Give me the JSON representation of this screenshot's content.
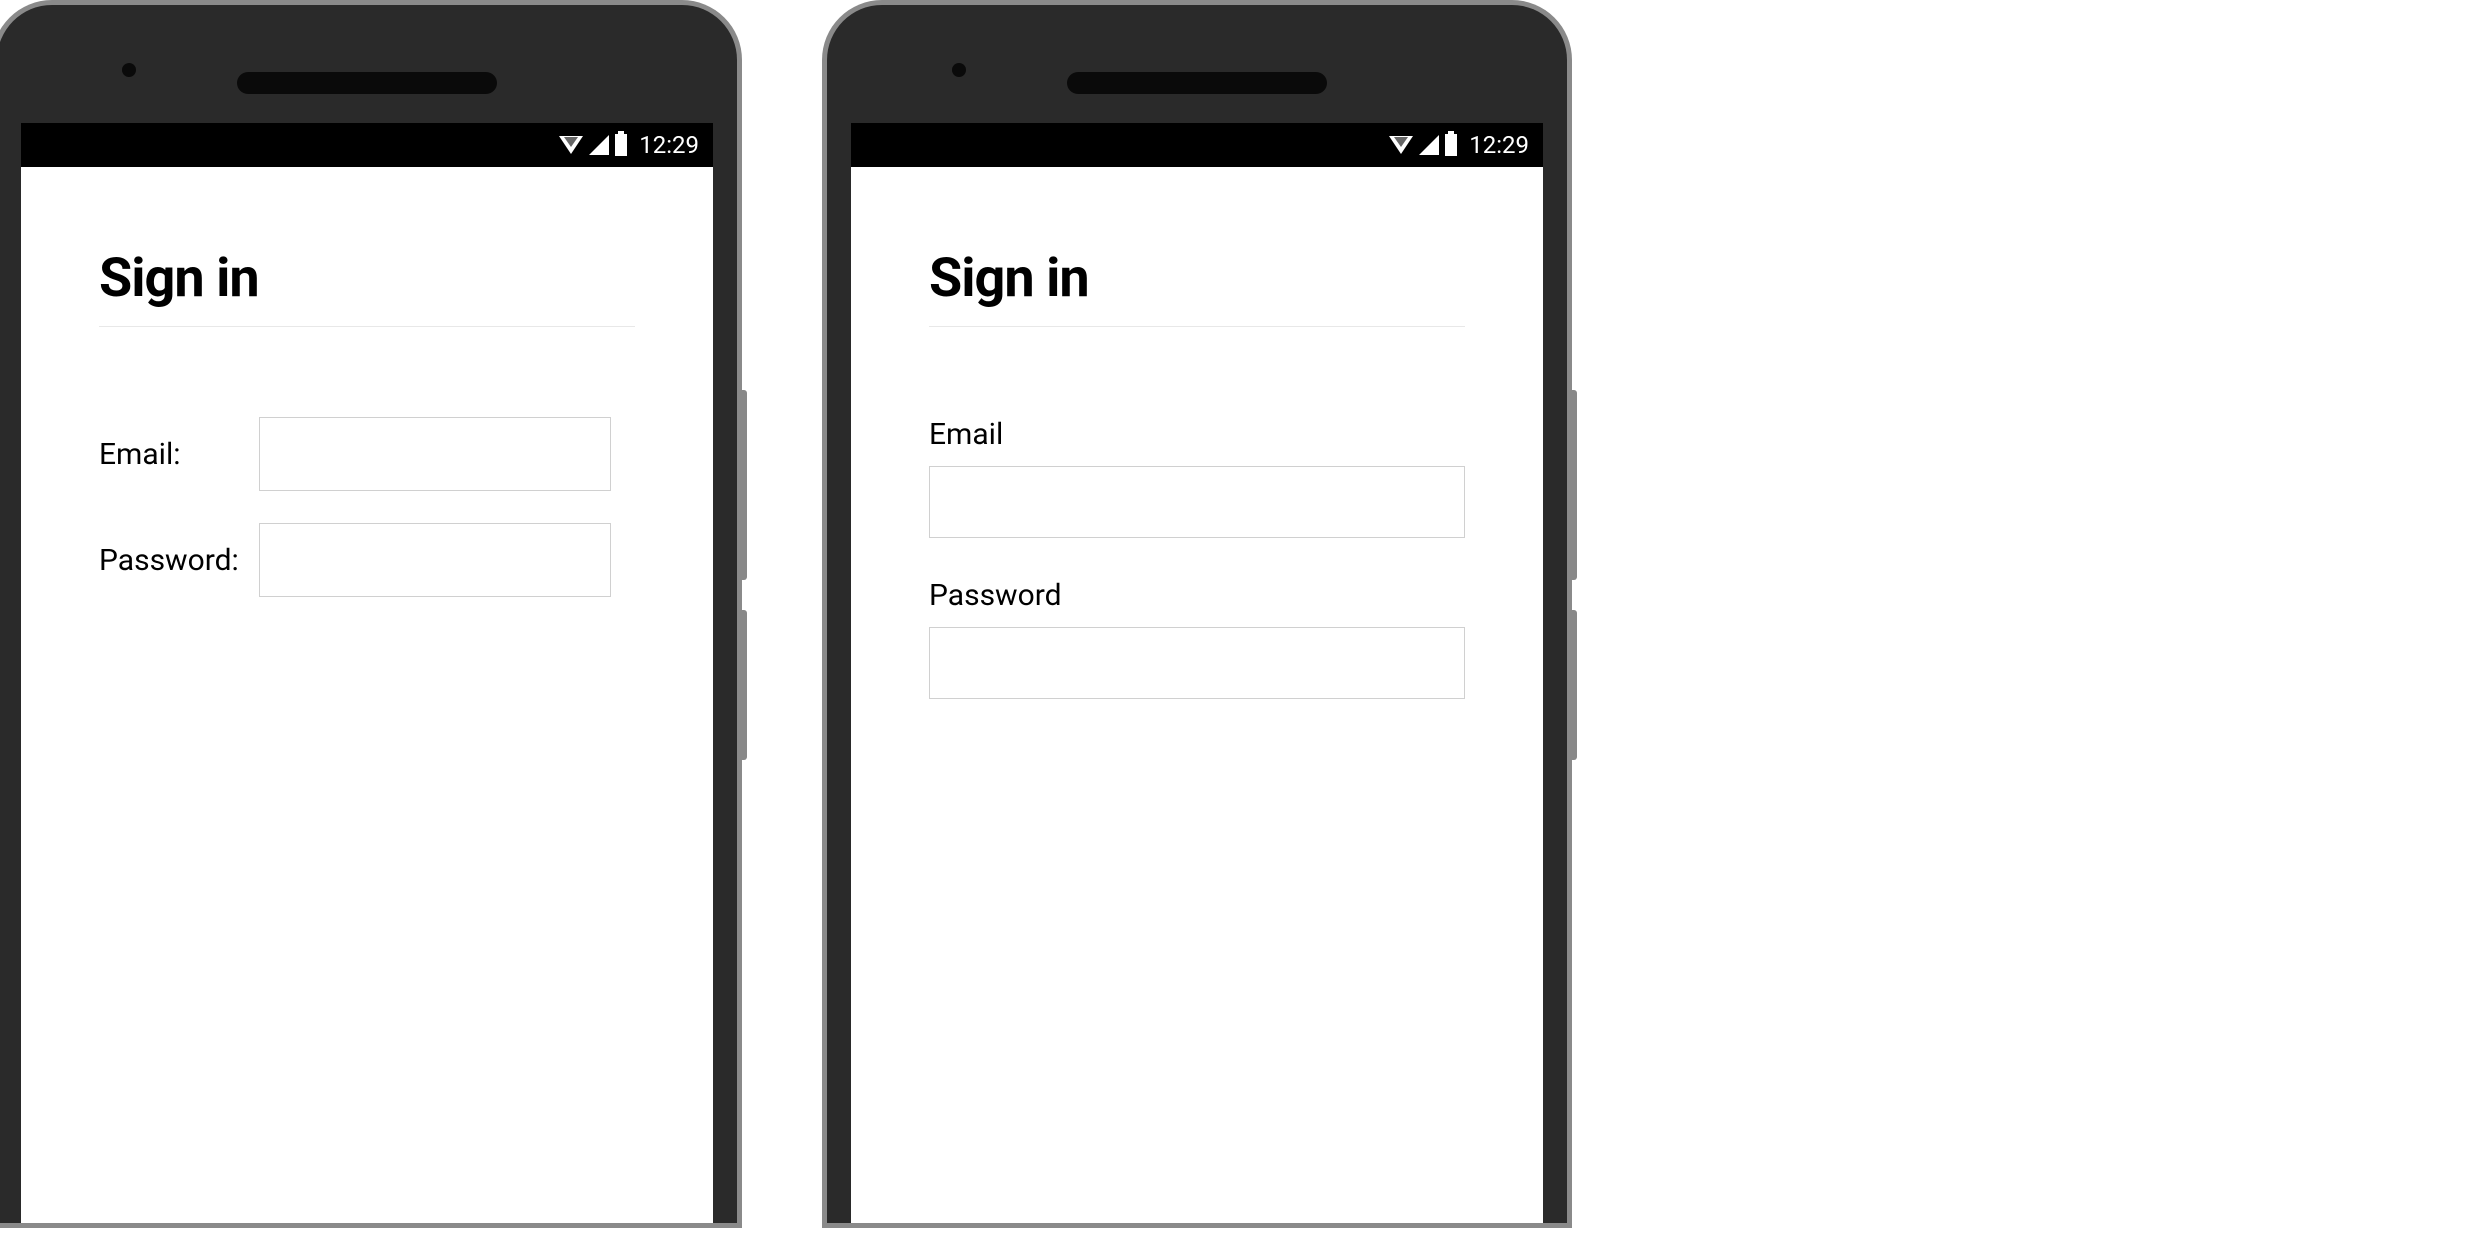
{
  "status_bar": {
    "time": "12:29"
  },
  "screens": {
    "left": {
      "title": "Sign in",
      "fields": {
        "email": {
          "label": "Email:",
          "value": ""
        },
        "password": {
          "label": "Password:",
          "value": ""
        }
      }
    },
    "right": {
      "title": "Sign in",
      "fields": {
        "email": {
          "label": "Email",
          "value": ""
        },
        "password": {
          "label": "Password",
          "value": ""
        }
      }
    }
  }
}
